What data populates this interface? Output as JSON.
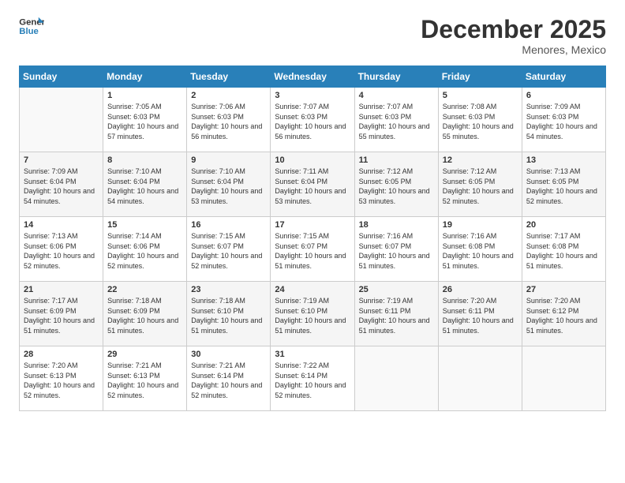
{
  "logo": {
    "line1": "General",
    "line2": "Blue"
  },
  "title": "December 2025",
  "subtitle": "Menores, Mexico",
  "days_header": [
    "Sunday",
    "Monday",
    "Tuesday",
    "Wednesday",
    "Thursday",
    "Friday",
    "Saturday"
  ],
  "weeks": [
    [
      {
        "num": "",
        "sunrise": "",
        "sunset": "",
        "daylight": ""
      },
      {
        "num": "1",
        "sunrise": "Sunrise: 7:05 AM",
        "sunset": "Sunset: 6:03 PM",
        "daylight": "Daylight: 10 hours and 57 minutes."
      },
      {
        "num": "2",
        "sunrise": "Sunrise: 7:06 AM",
        "sunset": "Sunset: 6:03 PM",
        "daylight": "Daylight: 10 hours and 56 minutes."
      },
      {
        "num": "3",
        "sunrise": "Sunrise: 7:07 AM",
        "sunset": "Sunset: 6:03 PM",
        "daylight": "Daylight: 10 hours and 56 minutes."
      },
      {
        "num": "4",
        "sunrise": "Sunrise: 7:07 AM",
        "sunset": "Sunset: 6:03 PM",
        "daylight": "Daylight: 10 hours and 55 minutes."
      },
      {
        "num": "5",
        "sunrise": "Sunrise: 7:08 AM",
        "sunset": "Sunset: 6:03 PM",
        "daylight": "Daylight: 10 hours and 55 minutes."
      },
      {
        "num": "6",
        "sunrise": "Sunrise: 7:09 AM",
        "sunset": "Sunset: 6:03 PM",
        "daylight": "Daylight: 10 hours and 54 minutes."
      }
    ],
    [
      {
        "num": "7",
        "sunrise": "Sunrise: 7:09 AM",
        "sunset": "Sunset: 6:04 PM",
        "daylight": "Daylight: 10 hours and 54 minutes."
      },
      {
        "num": "8",
        "sunrise": "Sunrise: 7:10 AM",
        "sunset": "Sunset: 6:04 PM",
        "daylight": "Daylight: 10 hours and 54 minutes."
      },
      {
        "num": "9",
        "sunrise": "Sunrise: 7:10 AM",
        "sunset": "Sunset: 6:04 PM",
        "daylight": "Daylight: 10 hours and 53 minutes."
      },
      {
        "num": "10",
        "sunrise": "Sunrise: 7:11 AM",
        "sunset": "Sunset: 6:04 PM",
        "daylight": "Daylight: 10 hours and 53 minutes."
      },
      {
        "num": "11",
        "sunrise": "Sunrise: 7:12 AM",
        "sunset": "Sunset: 6:05 PM",
        "daylight": "Daylight: 10 hours and 53 minutes."
      },
      {
        "num": "12",
        "sunrise": "Sunrise: 7:12 AM",
        "sunset": "Sunset: 6:05 PM",
        "daylight": "Daylight: 10 hours and 52 minutes."
      },
      {
        "num": "13",
        "sunrise": "Sunrise: 7:13 AM",
        "sunset": "Sunset: 6:05 PM",
        "daylight": "Daylight: 10 hours and 52 minutes."
      }
    ],
    [
      {
        "num": "14",
        "sunrise": "Sunrise: 7:13 AM",
        "sunset": "Sunset: 6:06 PM",
        "daylight": "Daylight: 10 hours and 52 minutes."
      },
      {
        "num": "15",
        "sunrise": "Sunrise: 7:14 AM",
        "sunset": "Sunset: 6:06 PM",
        "daylight": "Daylight: 10 hours and 52 minutes."
      },
      {
        "num": "16",
        "sunrise": "Sunrise: 7:15 AM",
        "sunset": "Sunset: 6:07 PM",
        "daylight": "Daylight: 10 hours and 52 minutes."
      },
      {
        "num": "17",
        "sunrise": "Sunrise: 7:15 AM",
        "sunset": "Sunset: 6:07 PM",
        "daylight": "Daylight: 10 hours and 51 minutes."
      },
      {
        "num": "18",
        "sunrise": "Sunrise: 7:16 AM",
        "sunset": "Sunset: 6:07 PM",
        "daylight": "Daylight: 10 hours and 51 minutes."
      },
      {
        "num": "19",
        "sunrise": "Sunrise: 7:16 AM",
        "sunset": "Sunset: 6:08 PM",
        "daylight": "Daylight: 10 hours and 51 minutes."
      },
      {
        "num": "20",
        "sunrise": "Sunrise: 7:17 AM",
        "sunset": "Sunset: 6:08 PM",
        "daylight": "Daylight: 10 hours and 51 minutes."
      }
    ],
    [
      {
        "num": "21",
        "sunrise": "Sunrise: 7:17 AM",
        "sunset": "Sunset: 6:09 PM",
        "daylight": "Daylight: 10 hours and 51 minutes."
      },
      {
        "num": "22",
        "sunrise": "Sunrise: 7:18 AM",
        "sunset": "Sunset: 6:09 PM",
        "daylight": "Daylight: 10 hours and 51 minutes."
      },
      {
        "num": "23",
        "sunrise": "Sunrise: 7:18 AM",
        "sunset": "Sunset: 6:10 PM",
        "daylight": "Daylight: 10 hours and 51 minutes."
      },
      {
        "num": "24",
        "sunrise": "Sunrise: 7:19 AM",
        "sunset": "Sunset: 6:10 PM",
        "daylight": "Daylight: 10 hours and 51 minutes."
      },
      {
        "num": "25",
        "sunrise": "Sunrise: 7:19 AM",
        "sunset": "Sunset: 6:11 PM",
        "daylight": "Daylight: 10 hours and 51 minutes."
      },
      {
        "num": "26",
        "sunrise": "Sunrise: 7:20 AM",
        "sunset": "Sunset: 6:11 PM",
        "daylight": "Daylight: 10 hours and 51 minutes."
      },
      {
        "num": "27",
        "sunrise": "Sunrise: 7:20 AM",
        "sunset": "Sunset: 6:12 PM",
        "daylight": "Daylight: 10 hours and 51 minutes."
      }
    ],
    [
      {
        "num": "28",
        "sunrise": "Sunrise: 7:20 AM",
        "sunset": "Sunset: 6:13 PM",
        "daylight": "Daylight: 10 hours and 52 minutes."
      },
      {
        "num": "29",
        "sunrise": "Sunrise: 7:21 AM",
        "sunset": "Sunset: 6:13 PM",
        "daylight": "Daylight: 10 hours and 52 minutes."
      },
      {
        "num": "30",
        "sunrise": "Sunrise: 7:21 AM",
        "sunset": "Sunset: 6:14 PM",
        "daylight": "Daylight: 10 hours and 52 minutes."
      },
      {
        "num": "31",
        "sunrise": "Sunrise: 7:22 AM",
        "sunset": "Sunset: 6:14 PM",
        "daylight": "Daylight: 10 hours and 52 minutes."
      },
      {
        "num": "",
        "sunrise": "",
        "sunset": "",
        "daylight": ""
      },
      {
        "num": "",
        "sunrise": "",
        "sunset": "",
        "daylight": ""
      },
      {
        "num": "",
        "sunrise": "",
        "sunset": "",
        "daylight": ""
      }
    ]
  ]
}
